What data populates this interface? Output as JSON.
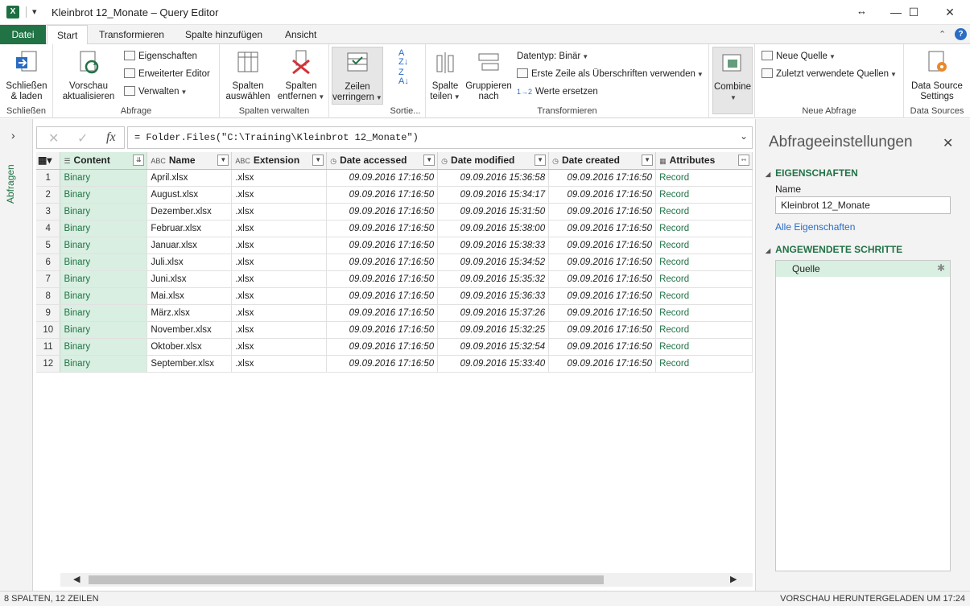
{
  "window": {
    "title": "Kleinbrot 12_Monate – Query Editor",
    "app_icon": "X",
    "qat_label": "▾",
    "resize_glyph": "↔",
    "minimize": "—",
    "maximize": "☐",
    "close": "✕"
  },
  "tabs": [
    "Datei",
    "Start",
    "Transformieren",
    "Spalte hinzufügen",
    "Ansicht"
  ],
  "ribbon": {
    "close_load": "Schließen & laden",
    "close_group": "Schließen",
    "refresh_preview": "Vorschau aktualisieren",
    "properties": "Eigenschaften",
    "advanced_editor": "Erweiterter Editor",
    "manage": "Verwalten",
    "query_group": "Abfrage",
    "choose_columns": "Spalten auswählen",
    "remove_columns": "Spalten entfernen",
    "columns_group": "Spalten verwalten",
    "reduce_rows": "Zeilen verringern",
    "sort_group": "Sortie...",
    "split_column": "Spalte teilen",
    "group_by": "Gruppieren nach",
    "data_type": "Datentyp: Binär",
    "first_row_headers": "Erste Zeile als Überschriften verwenden",
    "replace_values": "Werte ersetzen",
    "transform_group": "Transformieren",
    "combine": "Combine",
    "new_source": "Neue Quelle",
    "recent_sources": "Zuletzt verwendete Quellen",
    "new_query_group": "Neue Abfrage",
    "ds_settings": "Data Source Settings",
    "ds_group": "Data Sources"
  },
  "leftnav": {
    "label": "Abfragen"
  },
  "formula": {
    "text": "= Folder.Files(\"C:\\Training\\Kleinbrot 12_Monate\")"
  },
  "table": {
    "columns": [
      "Content",
      "Name",
      "Extension",
      "Date accessed",
      "Date modified",
      "Date created",
      "Attributes"
    ],
    "rows": [
      [
        "1",
        "Binary",
        "April.xlsx",
        ".xlsx",
        "09.09.2016 17:16:50",
        "09.09.2016 15:36:58",
        "09.09.2016 17:16:50",
        "Record"
      ],
      [
        "2",
        "Binary",
        "August.xlsx",
        ".xlsx",
        "09.09.2016 17:16:50",
        "09.09.2016 15:34:17",
        "09.09.2016 17:16:50",
        "Record"
      ],
      [
        "3",
        "Binary",
        "Dezember.xlsx",
        ".xlsx",
        "09.09.2016 17:16:50",
        "09.09.2016 15:31:50",
        "09.09.2016 17:16:50",
        "Record"
      ],
      [
        "4",
        "Binary",
        "Februar.xlsx",
        ".xlsx",
        "09.09.2016 17:16:50",
        "09.09.2016 15:38:00",
        "09.09.2016 17:16:50",
        "Record"
      ],
      [
        "5",
        "Binary",
        "Januar.xlsx",
        ".xlsx",
        "09.09.2016 17:16:50",
        "09.09.2016 15:38:33",
        "09.09.2016 17:16:50",
        "Record"
      ],
      [
        "6",
        "Binary",
        "Juli.xlsx",
        ".xlsx",
        "09.09.2016 17:16:50",
        "09.09.2016 15:34:52",
        "09.09.2016 17:16:50",
        "Record"
      ],
      [
        "7",
        "Binary",
        "Juni.xlsx",
        ".xlsx",
        "09.09.2016 17:16:50",
        "09.09.2016 15:35:32",
        "09.09.2016 17:16:50",
        "Record"
      ],
      [
        "8",
        "Binary",
        "Mai.xlsx",
        ".xlsx",
        "09.09.2016 17:16:50",
        "09.09.2016 15:36:33",
        "09.09.2016 17:16:50",
        "Record"
      ],
      [
        "9",
        "Binary",
        "März.xlsx",
        ".xlsx",
        "09.09.2016 17:16:50",
        "09.09.2016 15:37:26",
        "09.09.2016 17:16:50",
        "Record"
      ],
      [
        "10",
        "Binary",
        "November.xlsx",
        ".xlsx",
        "09.09.2016 17:16:50",
        "09.09.2016 15:32:25",
        "09.09.2016 17:16:50",
        "Record"
      ],
      [
        "11",
        "Binary",
        "Oktober.xlsx",
        ".xlsx",
        "09.09.2016 17:16:50",
        "09.09.2016 15:32:54",
        "09.09.2016 17:16:50",
        "Record"
      ],
      [
        "12",
        "Binary",
        "September.xlsx",
        ".xlsx",
        "09.09.2016 17:16:50",
        "09.09.2016 15:33:40",
        "09.09.2016 17:16:50",
        "Record"
      ]
    ]
  },
  "settings": {
    "title": "Abfrageeinstellungen",
    "properties": "EIGENSCHAFTEN",
    "name_label": "Name",
    "name_value": "Kleinbrot 12_Monate",
    "all_properties": "Alle Eigenschaften",
    "applied_steps": "ANGEWENDETE SCHRITTE",
    "steps": [
      "Quelle"
    ]
  },
  "status": {
    "left": "8 SPALTEN, 12 ZEILEN",
    "right": "VORSCHAU HERUNTERGELADEN UM 17:24"
  },
  "colors": {
    "accent": "#217346",
    "content_bg": "#d9efe1"
  }
}
